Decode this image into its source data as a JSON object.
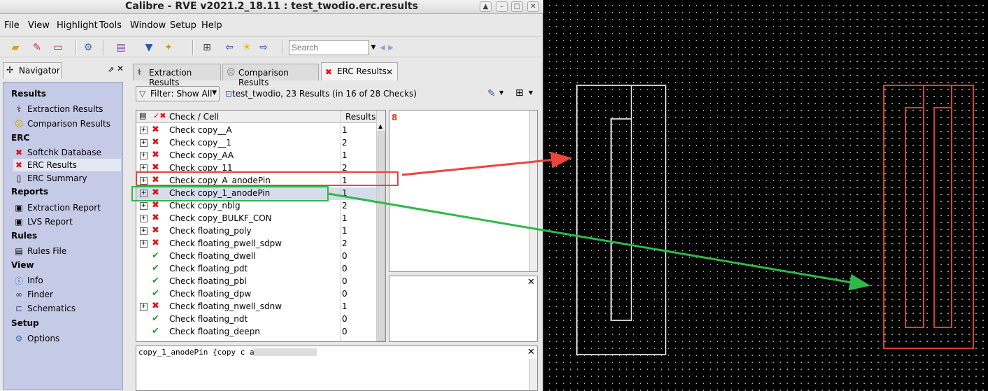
{
  "window": {
    "title": "Calibre - RVE v2021.2_18.11 : test_twodio.erc.results"
  },
  "menu": [
    "File",
    "View",
    "Highlight",
    "Tools",
    "Window",
    "Setup",
    "Help"
  ],
  "toolbar": {
    "search_placeholder": "Search"
  },
  "navigator": {
    "title": "Navigator",
    "sections": [
      {
        "label": "Results",
        "items": [
          {
            "label": "Extraction Results",
            "icon": "extraction-icon"
          },
          {
            "label": "Comparison Results",
            "icon": "sad-face-icon"
          }
        ]
      },
      {
        "label": "ERC",
        "items": [
          {
            "label": "Softchk Database",
            "icon": "red-x-icon"
          },
          {
            "label": "ERC Results",
            "icon": "red-x-icon",
            "selected": true
          },
          {
            "label": "ERC Summary",
            "icon": "document-icon"
          }
        ]
      },
      {
        "label": "Reports",
        "items": [
          {
            "label": "Extraction Report",
            "icon": "report-icon"
          },
          {
            "label": "LVS Report",
            "icon": "report-icon"
          }
        ]
      },
      {
        "label": "Rules",
        "items": [
          {
            "label": "Rules File",
            "icon": "rules-file-icon"
          }
        ]
      },
      {
        "label": "View",
        "items": [
          {
            "label": "Info",
            "icon": "info-icon"
          },
          {
            "label": "Finder",
            "icon": "binoculars-icon"
          },
          {
            "label": "Schematics",
            "icon": "schematic-icon"
          }
        ]
      },
      {
        "label": "Setup",
        "items": [
          {
            "label": "Options",
            "icon": "gear-icon"
          }
        ]
      }
    ]
  },
  "tabs": [
    {
      "label": "Extraction Results",
      "active": false
    },
    {
      "label": "Comparison Results",
      "active": false
    },
    {
      "label": "ERC Results",
      "active": true
    }
  ],
  "filter": {
    "label": "Filter: Show All"
  },
  "db_info": "test_twodio, 23 Results (in 16 of 28 Checks)",
  "checks_table": {
    "columns": [
      "Check / Cell",
      "Results"
    ],
    "rows": [
      {
        "name": "Check copy__A",
        "results": "1",
        "status": "fail"
      },
      {
        "name": "Check copy__1",
        "results": "2",
        "status": "fail"
      },
      {
        "name": "Check copy_AA",
        "results": "1",
        "status": "fail"
      },
      {
        "name": "Check copy_11",
        "results": "2",
        "status": "fail"
      },
      {
        "name": "Check copy_A_anodePin",
        "results": "1",
        "status": "fail"
      },
      {
        "name": "Check copy_1_anodePin",
        "results": "1",
        "status": "fail",
        "selected": true
      },
      {
        "name": "Check copy_nblg",
        "results": "2",
        "status": "fail"
      },
      {
        "name": "Check copy_BULKF_CON",
        "results": "1",
        "status": "fail"
      },
      {
        "name": "Check floating_poly",
        "results": "1",
        "status": "fail"
      },
      {
        "name": "Check floating_pwell_sdpw",
        "results": "2",
        "status": "fail"
      },
      {
        "name": "Check floating_dwell",
        "results": "0",
        "status": "pass"
      },
      {
        "name": "Check floating_pdt",
        "results": "0",
        "status": "pass"
      },
      {
        "name": "Check floating_pbl",
        "results": "0",
        "status": "pass"
      },
      {
        "name": "Check floating_dpw",
        "results": "0",
        "status": "pass"
      },
      {
        "name": "Check floating_nwell_sdnw",
        "results": "1",
        "status": "fail"
      },
      {
        "name": "Check floating_ndt",
        "results": "0",
        "status": "pass"
      },
      {
        "name": "Check floating_deepn",
        "results": "0",
        "status": "pass"
      }
    ]
  },
  "detail": {
    "count": "8"
  },
  "check_text": "copy_1_anodePin {copy c                   anodePin}",
  "colors": {
    "annotation_red": "#e8453c",
    "annotation_green": "#2fb84a",
    "shape_gray": "#c8c8c8",
    "shape_red": "#d2462d",
    "nav_panel": "#c5cbe6"
  }
}
